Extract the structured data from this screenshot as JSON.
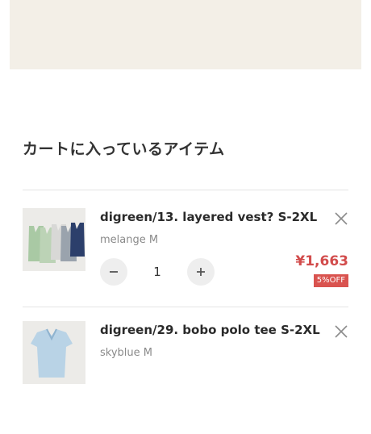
{
  "cart": {
    "title": "カートに入っているアイテム",
    "items": [
      {
        "name": "digreen/13. layered vest? S-2XL",
        "variant": "melange M",
        "quantity": "1",
        "price": "¥1,663",
        "discount_badge": "5%OFF"
      },
      {
        "name": "digreen/29. bobo polo tee S-2XL",
        "variant": "skyblue M"
      }
    ]
  },
  "colors": {
    "accent_price": "#d24c4c",
    "badge_bg": "#d9534f",
    "banner_bg": "#f3efe7"
  },
  "icons": {
    "remove": "close-icon",
    "decrease": "minus-icon",
    "increase": "plus-icon"
  }
}
